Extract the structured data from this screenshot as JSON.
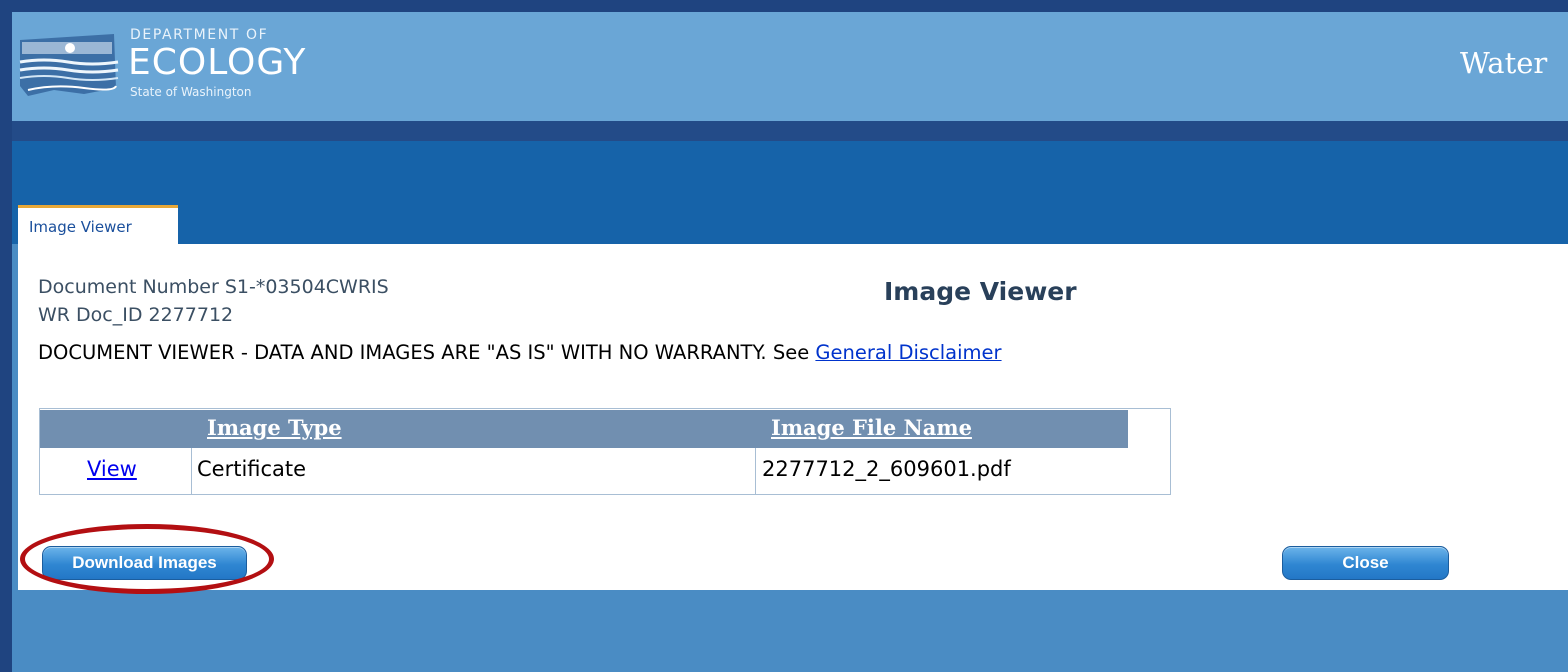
{
  "header": {
    "logo": {
      "line1": "DEPARTMENT OF",
      "line2": "ECOLOGY",
      "line3": "State of Washington"
    },
    "right_title": "Water"
  },
  "tab": {
    "label": "Image Viewer"
  },
  "document": {
    "number_text": "Document Number S1-*03504CWRIS",
    "doc_id_text": "WR Doc_ID 2277712",
    "title": "Image Viewer",
    "disclaimer_text": "DOCUMENT VIEWER - DATA AND IMAGES ARE \"AS IS\" WITH NO WARRANTY. See ",
    "disclaimer_link": "General Disclaimer"
  },
  "table": {
    "headers": {
      "type": "Image Type",
      "file": "Image File Name"
    },
    "rows": [
      {
        "action": "View",
        "type": "Certificate",
        "file": "2277712_2_609601.pdf"
      }
    ]
  },
  "buttons": {
    "download": "Download Images",
    "close": "Close"
  },
  "colors": {
    "page_border": "#1f4480",
    "header_bg": "#6aa6d6",
    "nav_bar": "#1663a9",
    "tab_accent": "#e8a838",
    "table_header": "#718fb0",
    "button": "#2f86d2",
    "annotation_circle": "#b30f12"
  },
  "icons": {
    "logo": "washington-state-map-logo-icon"
  },
  "annotation": {
    "description": "red-circle-highlighting-download-button"
  }
}
